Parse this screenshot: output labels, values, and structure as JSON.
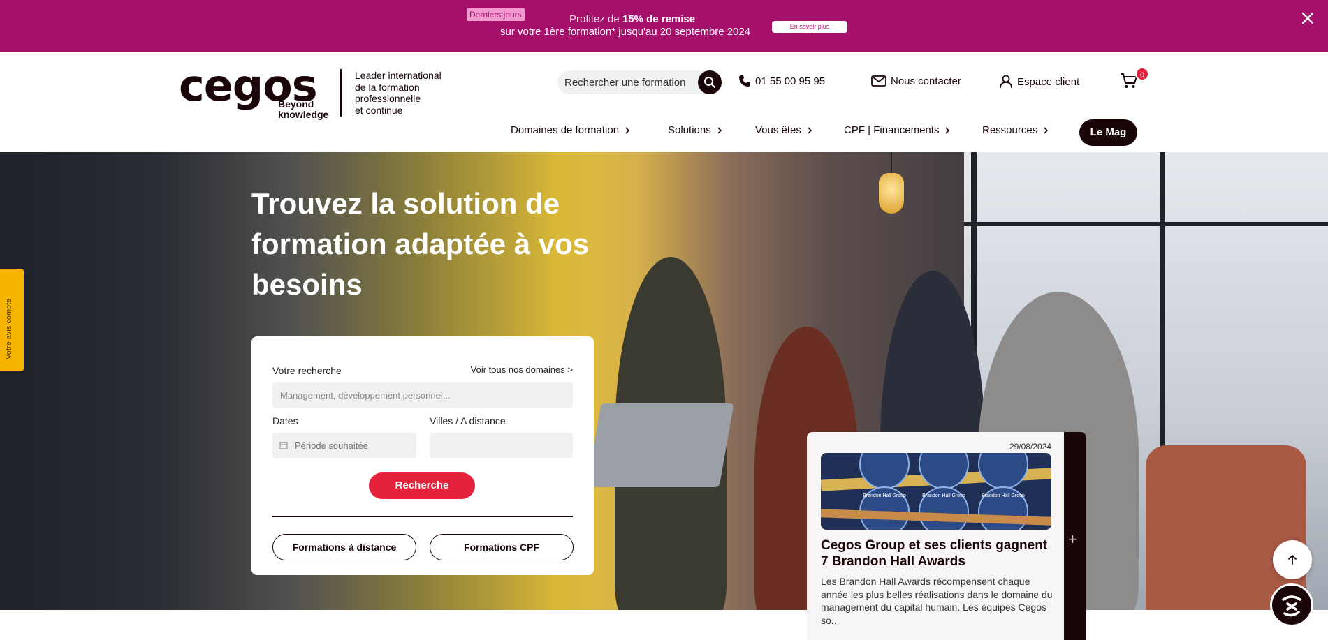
{
  "promo": {
    "badge": "Derniers jours",
    "line1_prefix": "Profitez de ",
    "line1_bold": "15% de remise",
    "line2": "sur votre 1ère formation* jusqu'au 20 septembre 2024",
    "button": "En savoir plus",
    "bg_color": "#a4106a"
  },
  "header": {
    "logo_word": "cegos",
    "logo_sub_1": "Beyond",
    "logo_sub_2": "knowledge",
    "tagline": [
      "Leader international",
      "de la formation",
      "professionnelle",
      "et continue"
    ],
    "search_placeholder": "Rechercher une formation",
    "phone": "01 55 00 95 95",
    "contact": "Nous contacter",
    "client": "Espace client",
    "cart_count": "0"
  },
  "nav": {
    "items": [
      "Domaines de formation",
      "Solutions",
      "Vous êtes",
      "CPF | Financements",
      "Ressources"
    ],
    "mag": "Le Mag"
  },
  "hero": {
    "title": "Trouvez la solution de formation adaptée à vos besoins"
  },
  "search_card": {
    "label_search": "Votre recherche",
    "link_domains": "Voir tous nos domaines >",
    "search_placeholder": "Management, développement personnel...",
    "label_dates": "Dates",
    "date_placeholder": "Période souhaitée",
    "label_cities": "Villes / A distance",
    "cities_value": "",
    "submit": "Recherche",
    "btn_distance": "Formations à distance",
    "btn_cpf": "Formations CPF",
    "accent": "#e4223b"
  },
  "feedback": {
    "label": "Votre avis compte"
  },
  "news": {
    "date": "29/08/2024",
    "title": "Cegos Group et ses clients gagnent 7 Brandon Hall Awards",
    "description": "Les Brandon Hall Awards récompensent chaque année les plus belles réalisations dans le domaine du management du capital humain. Les équipes Cegos so...",
    "award_text": "Brandon Hall Group"
  }
}
